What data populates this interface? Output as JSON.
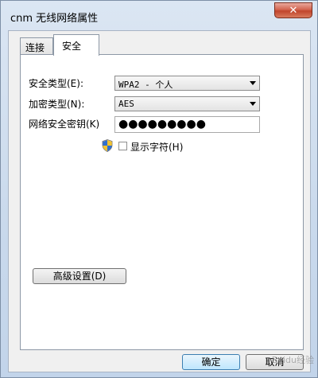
{
  "window": {
    "title": "cnm 无线网络属性",
    "close_glyph": "✕"
  },
  "tabs": [
    {
      "label": "连接",
      "active": false
    },
    {
      "label": "安全",
      "active": true
    }
  ],
  "security": {
    "security_type_label": "安全类型(E):",
    "security_type_value": "WPA2 - 个人",
    "encryption_type_label": "加密类型(N):",
    "encryption_type_value": "AES",
    "key_label": "网络安全密钥(K)",
    "key_value": "●●●●●●●●●",
    "show_chars_label": "显示字符(H)",
    "show_chars_checked": false,
    "advanced_button": "高级设置(D)"
  },
  "buttons": {
    "ok": "确定",
    "cancel": "取消"
  },
  "watermark": "Baidu经验"
}
